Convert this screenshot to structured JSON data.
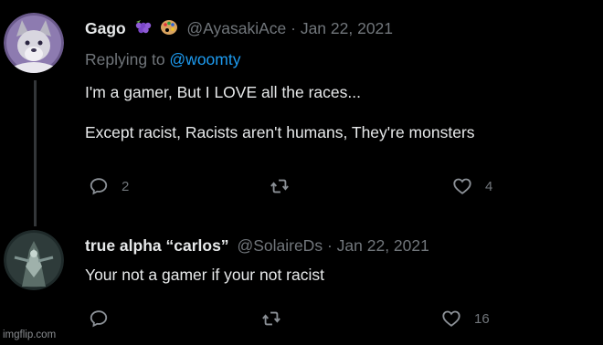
{
  "tweets": [
    {
      "name": "Gago",
      "emoji": [
        "grapes-emoji",
        "palette-emoji"
      ],
      "handle": "@AyasakiAce",
      "separator": "·",
      "date": "Jan 22, 2021",
      "replying_prefix": "Replying to ",
      "replying_to": "@woomty",
      "text": "I'm a gamer, But I LOVE all the races...\n\nExcept racist, Racists aren't humans, They're monsters",
      "replies": "2",
      "retweets": "",
      "likes": "4"
    },
    {
      "name": "true alpha “carlos”",
      "handle": "@SolaireDs",
      "separator": "·",
      "date": "Jan 22, 2021",
      "text": "Your not a gamer if your not racist",
      "replies": "",
      "retweets": "",
      "likes": "16"
    }
  ],
  "icons": {
    "reply": "reply-icon",
    "retweet": "retweet-icon",
    "like": "heart-icon"
  },
  "colors": {
    "background": "#000000",
    "text": "#e7e9ea",
    "muted": "#71767b",
    "link": "#1d9bf0"
  },
  "watermark": "imgflip.com"
}
